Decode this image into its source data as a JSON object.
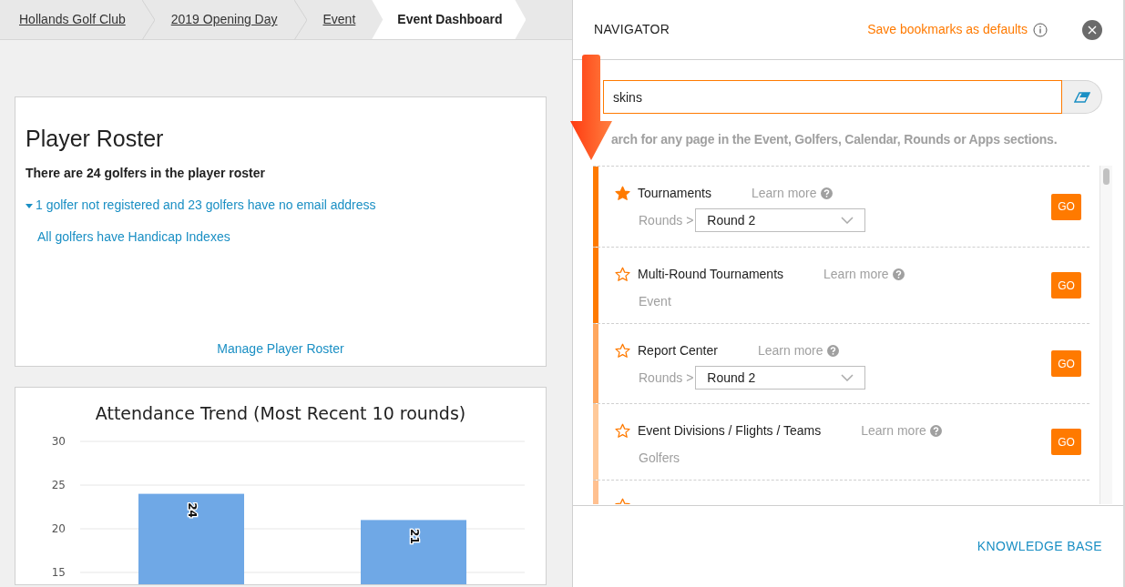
{
  "breadcrumbs": [
    {
      "label": "Hollands Golf Club",
      "selected": false
    },
    {
      "label": "2019 Opening Day",
      "selected": false
    },
    {
      "label": "Event",
      "selected": false
    },
    {
      "label": "Event Dashboard",
      "selected": true
    }
  ],
  "player_roster": {
    "title": "Player Roster",
    "summary": "There are 24 golfers in the player roster",
    "warning": "1 golfer not registered and 23 golfers have no email address",
    "warning_expanded": true,
    "handicap_note": "All golfers have Handicap Indexes",
    "link": "Manage Player Roster"
  },
  "attendance": {
    "chart_data": {
      "type": "bar",
      "title": "Attendance Trend (Most Recent 10 rounds)",
      "values": [
        24,
        21
      ],
      "yticks": [
        15,
        20,
        25,
        30
      ],
      "ylim": [
        15,
        30
      ],
      "data_labels": true
    }
  },
  "navigator": {
    "title": "NAVIGATOR",
    "save_link": "Save bookmarks as defaults",
    "search": {
      "value": "skins"
    },
    "hint": "arch for any page in the Event, Golfers, Calendar, Rounds or Apps sections.",
    "items": [
      {
        "title": "Tournaments",
        "bookmarked": true,
        "learn_more": "Learn more",
        "color": "#ff7a00",
        "kind": "dropdown",
        "path": "Rounds >",
        "value": "Round 2",
        "go": "GO"
      },
      {
        "title": "Multi-Round Tournaments",
        "bookmarked": false,
        "learn_more": "Learn more",
        "color": "#ff7a00",
        "kind": "section",
        "section": "Event",
        "go": "GO"
      },
      {
        "title": "Report Center",
        "bookmarked": false,
        "learn_more": "Learn more",
        "color": "#ffa75e",
        "kind": "dropdown",
        "path": "Rounds >",
        "value": "Round 2",
        "go": "GO"
      },
      {
        "title": "Event Divisions / Flights / Teams",
        "bookmarked": false,
        "learn_more": "Learn more",
        "color": "#ffc999",
        "kind": "section",
        "section": "Golfers",
        "go": "GO"
      },
      {
        "bookmarked": false,
        "color": "#ffc090",
        "kind": "cut"
      }
    ],
    "footer_link": "KNOWLEDGE BASE"
  }
}
